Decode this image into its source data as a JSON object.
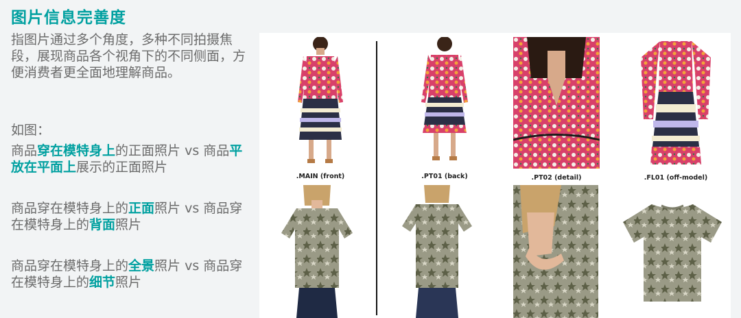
{
  "title": "图片信息完善度",
  "intro": "指图片通过多个角度，多种不同拍摄焦段，展现商品各个视角下的不同侧面，方便消费者更全面地理解商品。",
  "example_label": "如图：",
  "compare1": {
    "a": "商品",
    "b": "穿在模特身上",
    "c": "的正面照片 vs 商品",
    "d": "平放在平面上",
    "e": "展示的正面照片"
  },
  "compare2": {
    "a": "商品穿在模特身上的",
    "b": "正面",
    "c": "照片 vs 商品穿在模特身上的",
    "d": "背面",
    "e": "照片"
  },
  "compare3": {
    "a": "商品穿在模特身上的",
    "b": "全景",
    "c": "照片 vs 商品穿在模特身上的",
    "d": "细节",
    "e": "照片"
  },
  "captions": [
    ".MAIN (front)",
    ".PT01 (back)",
    ".PT02 (detail)",
    ".FL01 (off-model)"
  ],
  "colors": {
    "accent": "#00a0a0",
    "body_text": "#6b6b6b",
    "background": "#f2f4f5"
  }
}
